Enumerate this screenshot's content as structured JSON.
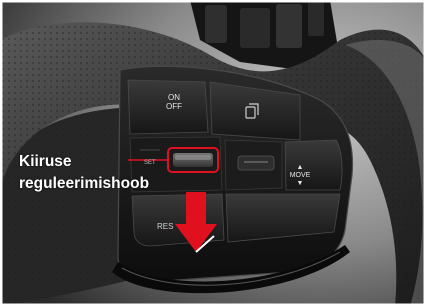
{
  "callout": {
    "line1": "Kiiruse",
    "line2": "reguleerimishoob",
    "color": "#ffffff"
  },
  "buttons": {
    "on_off_line1": "ON",
    "on_off_line2": "OFF",
    "set": "SET",
    "res": "RES",
    "move_line1": "▲",
    "move_line2": "MOVE",
    "move_line3": "▼"
  },
  "colors": {
    "highlight": "#e0101e",
    "arrow": "#e0101e",
    "wheel": "#2b2b2b",
    "panel": "#141414"
  },
  "icons": {
    "arrow": "arrow-down-icon",
    "lane": "lane-assist-icon"
  }
}
